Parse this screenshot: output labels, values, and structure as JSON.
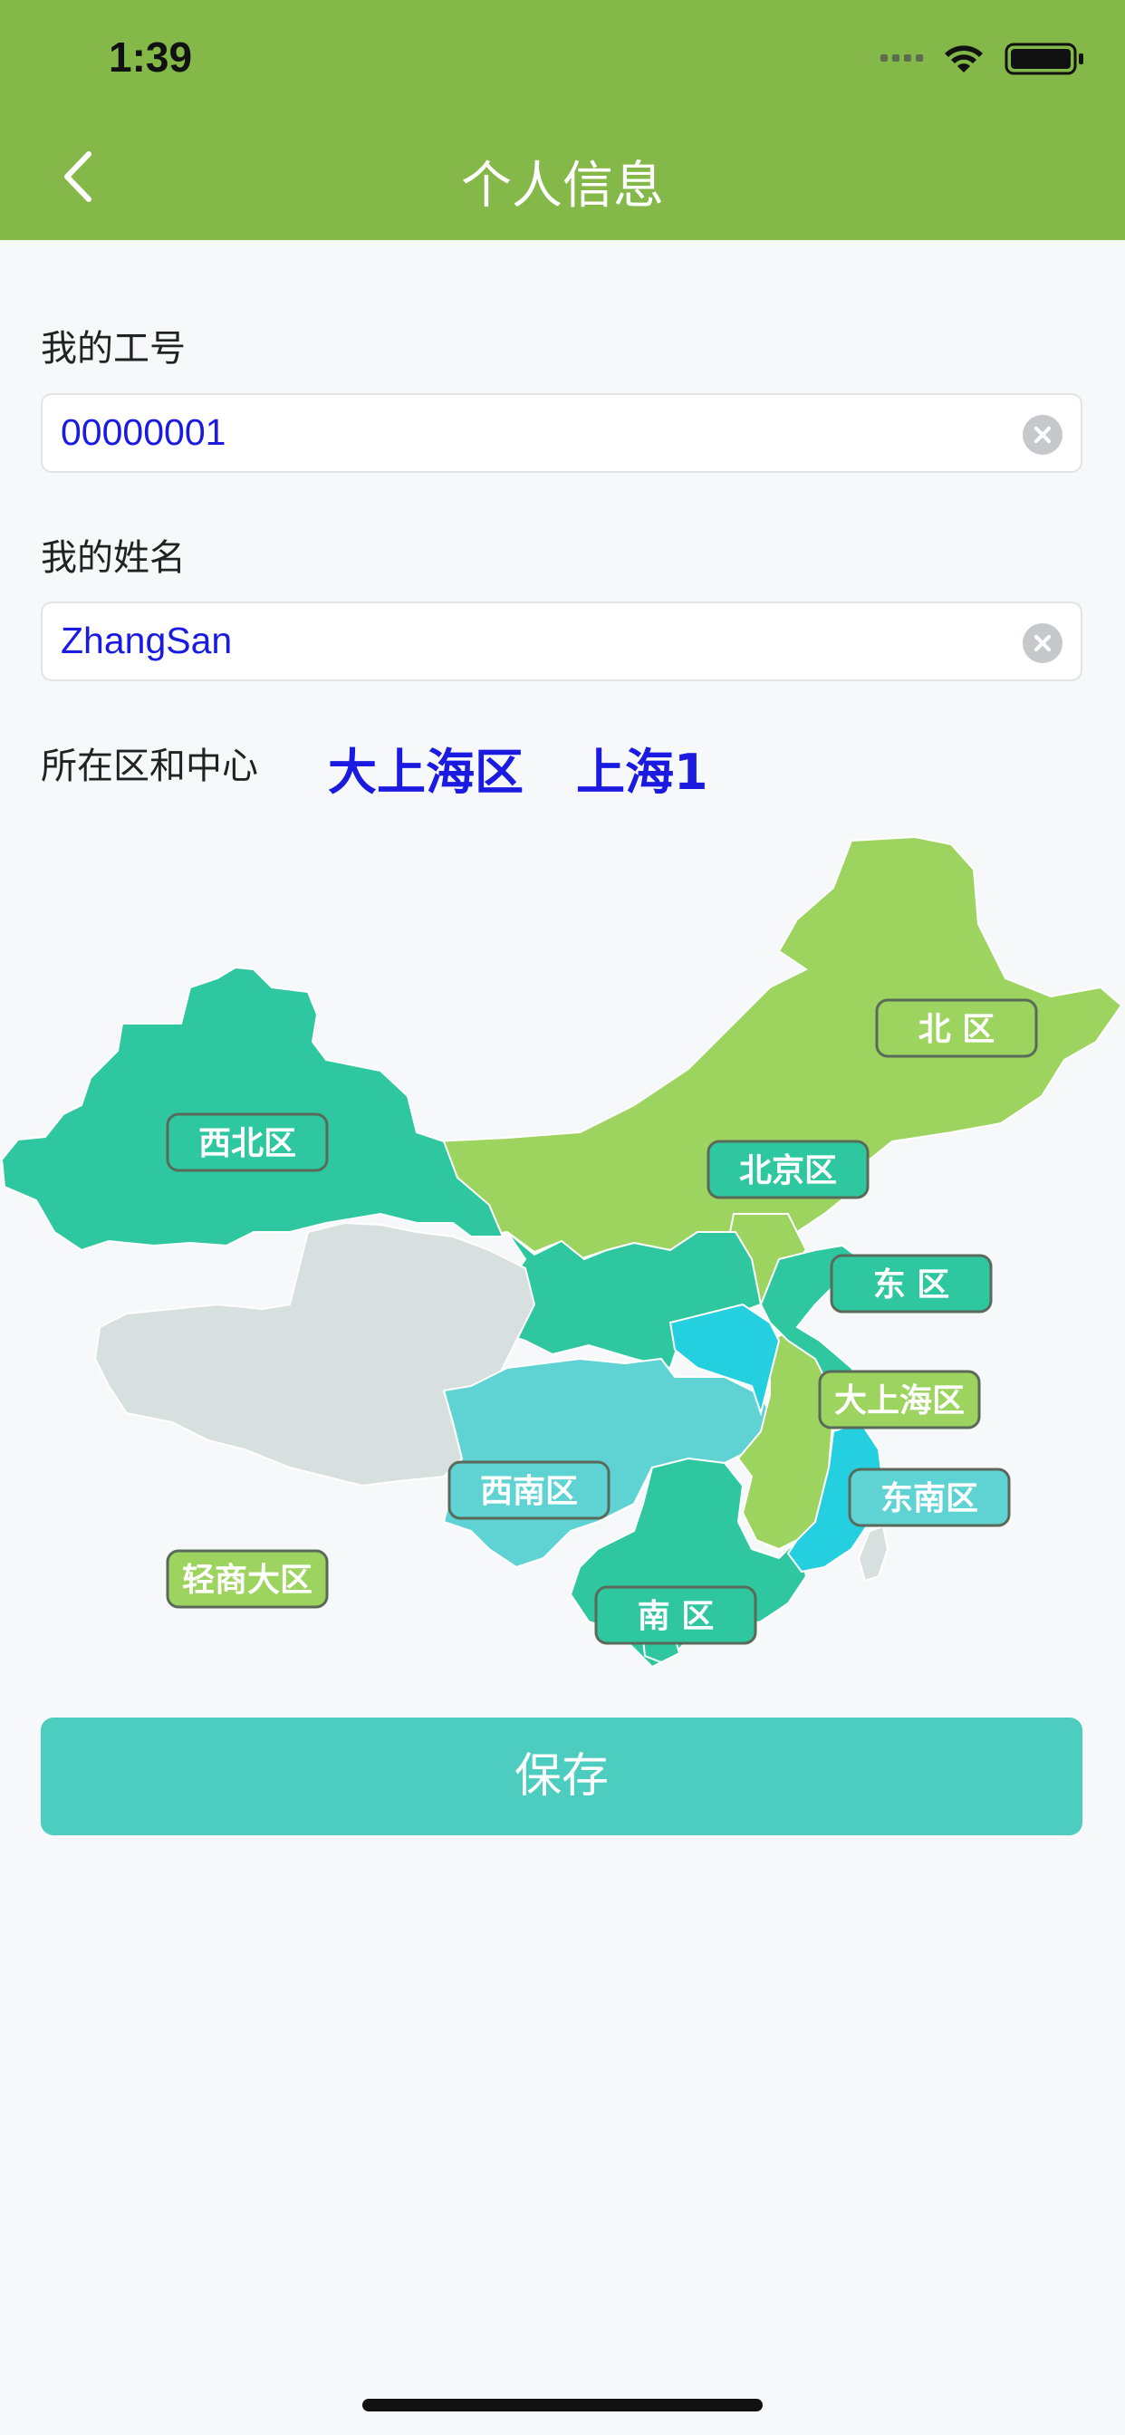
{
  "status_bar": {
    "time": "1:39"
  },
  "nav": {
    "title": "个人信息"
  },
  "form": {
    "employee_id_label": "我的工号",
    "employee_id_value": "00000001",
    "name_label": "我的姓名",
    "name_value": "ZhangSan",
    "region_label": "所在区和中心",
    "region_value": "大上海区",
    "center_value": "上海1"
  },
  "map": {
    "regions": [
      "北 区",
      "西北区",
      "北京区",
      "东 区",
      "大上海区",
      "西南区",
      "东南区",
      "轻商大区",
      "南 区"
    ]
  },
  "actions": {
    "save_label": "保存"
  },
  "colors": {
    "header": "#84b848",
    "input_text": "#1a1ae0",
    "save_button": "#4ccdbf",
    "map_green_light": "#9dd35f",
    "map_teal": "#2ec79f",
    "map_gray": "#d8e0df",
    "map_cyan": "#5fd3d3",
    "map_blue": "#24cfe0"
  }
}
